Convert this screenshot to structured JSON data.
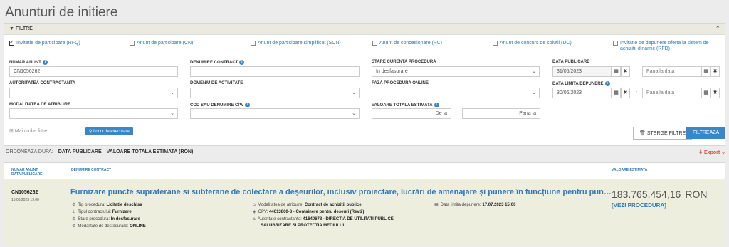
{
  "page": {
    "title": "Anunturi de initiere"
  },
  "filters": {
    "header_label": "FILTRE",
    "types": [
      {
        "label": "Invitatie de participare (RFQ)",
        "checked": true
      },
      {
        "label": "Anunt de participare (CN)",
        "checked": false
      },
      {
        "label": "Anunt de participare simplificat (SCN)",
        "checked": false
      },
      {
        "label": "Anunt de concesionare (PC)",
        "checked": false
      },
      {
        "label": "Anunt de concurs de solutii (DC)",
        "checked": false
      },
      {
        "label": "Invitatie de depunere oferta la sistem de achizitii dinamic (RFD)",
        "checked": false
      }
    ],
    "numar_anunt": {
      "label": "NUMAR ANUNT",
      "value": "CN1056262"
    },
    "denumire_contract": {
      "label": "DENUMIRE CONTRACT",
      "value": ""
    },
    "stare_curenta": {
      "label": "STARE CURENTA PROCEDURA",
      "value": "In desfasurare"
    },
    "data_publicare": {
      "label": "DATA PUBLICARE",
      "from": "31/05/2023",
      "to_placeholder": "Pana la data"
    },
    "autoritatea": {
      "label": "AUTORITATEA CONTRACTANTA",
      "value": ""
    },
    "domeniu": {
      "label": "DOMENIU DE ACTIVITATE",
      "value": ""
    },
    "faza": {
      "label": "FAZA PROCEDURA ONLINE",
      "value": ""
    },
    "data_limita": {
      "label": "DATA LIMITA DEPUNERE",
      "from": "30/06/2023",
      "to_placeholder": "Pana la data"
    },
    "modalitatea": {
      "label": "MODALITATEA DE ATRIBUIRE",
      "value": ""
    },
    "cod_cpv": {
      "label": "COD SAU DENUMIRE CPV",
      "value": ""
    },
    "valoare": {
      "label": "VALOARE TOTALA ESTIMATA",
      "from_placeholder": "De la",
      "to_placeholder": "Pana la"
    },
    "mai_multe": "Mai multe filtre",
    "locul": "Locul de executare",
    "sterge": "STERGE FILTRE",
    "filtreaza": "FILTREAZA"
  },
  "sort": {
    "label": "ORDONEAZA DUPA:",
    "options": [
      "DATA PUBLICARE",
      "VALOARE TOTALA ESTIMATA (RON)"
    ],
    "export": "Export"
  },
  "results": {
    "headers": {
      "col1_line1": "NUMAR ANUNT",
      "col1_line2": "DATA PUBLICARE",
      "col2": "DENUMIRE CONTRACT",
      "col3": "VALOARE ESTIMATA"
    },
    "rows": [
      {
        "number": "CN1056262",
        "date": "15.06.2023 19:00",
        "title": "Furnizare puncte supraterane si subterane de colectare a deșeurilor, inclusiv proiectare, lucrări de amenajare și punere în funcțiune pentru punctele suprat…",
        "tip_procedura_label": "Tip procedura:",
        "tip_procedura": "Licitatie deschisa",
        "tipul_contractului_label": "Tipul contractului:",
        "tipul_contractului": "Furnizare",
        "stare_label": "Stare procedura:",
        "stare": "In desfasurare",
        "modalitate_desf_label": "Modalitate de desfasurare:",
        "modalitate_desf": "ONLINE",
        "modalitatea_atr_label": "Modalitatea de atribuire:",
        "modalitatea_atr": "Contract de achizitii publice",
        "cpv_label": "CPV:",
        "cpv": "44613800-8 - Containere pentru deseuri (Rev.2)",
        "autoritate_label": "Autoritate contractanta:",
        "autoritate": "41640678 - DIRECTIA DE UTILITATI PUBLICE,",
        "autoritate_line2": "SALUBRIZARE SI PROTECTIA MEDIULUI",
        "data_limita_label": "Data limita depunere:",
        "data_limita": "17.07.2023 15:00",
        "valoare": "183.765.454,16",
        "moneda": "RON",
        "vezi": "[VEZI PROCEDURA]"
      }
    ]
  }
}
